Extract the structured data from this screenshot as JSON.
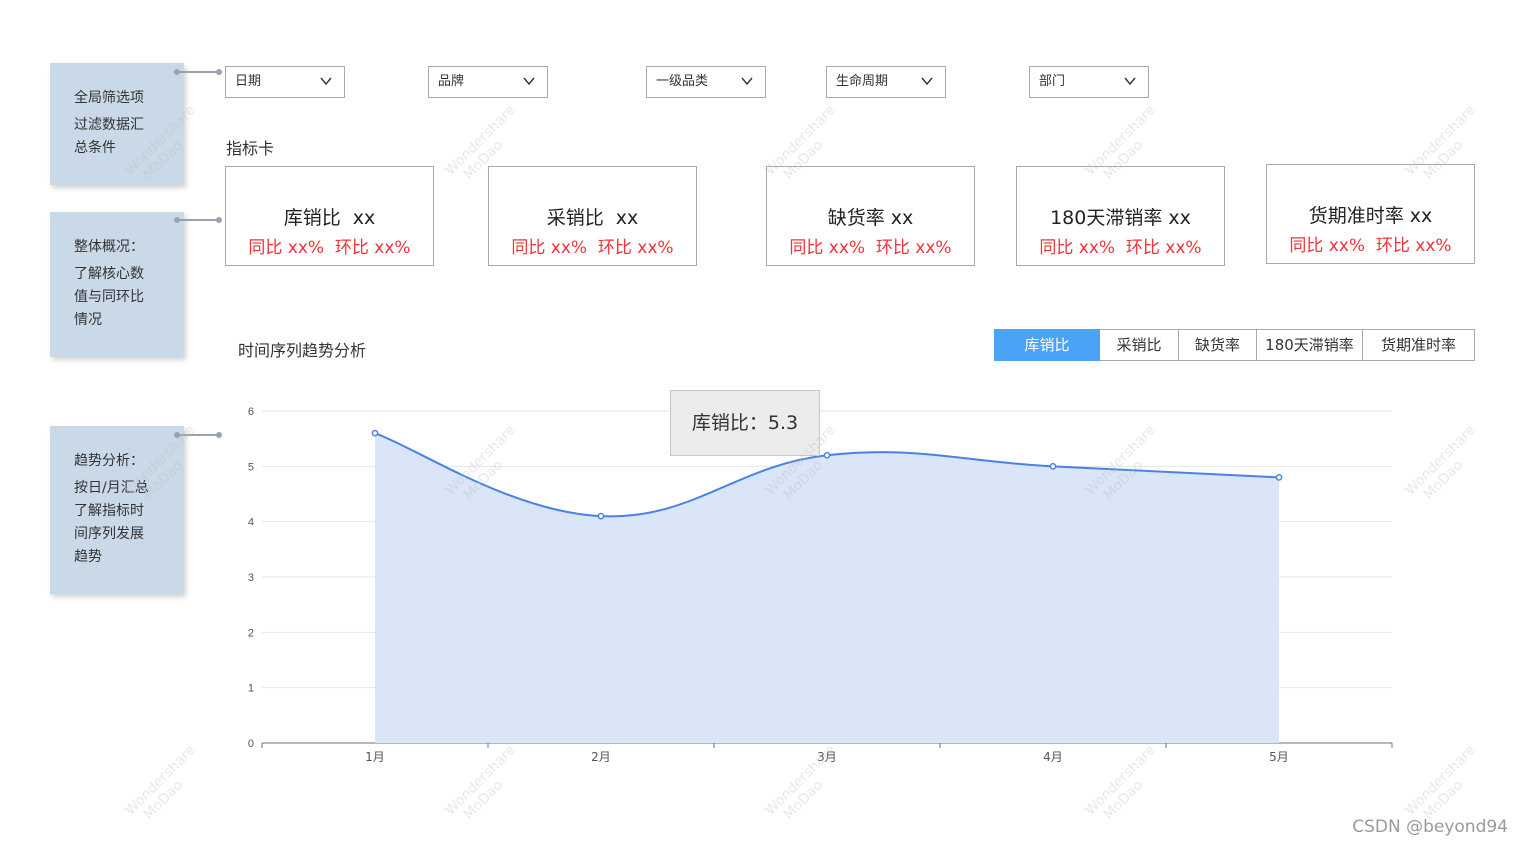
{
  "notes": [
    {
      "lines": [
        "全局筛选项",
        "过滤数据汇",
        "总条件"
      ]
    },
    {
      "lines": [
        "整体概况：",
        "了解核心数",
        "值与同环比",
        "情况"
      ]
    },
    {
      "lines": [
        "趋势分析：",
        "按日/月汇总",
        "了解指标时",
        "间序列发展",
        "趋势"
      ]
    }
  ],
  "filters": [
    {
      "label": "日期"
    },
    {
      "label": "品牌"
    },
    {
      "label": "一级品类"
    },
    {
      "label": "生命周期"
    },
    {
      "label": "部门"
    }
  ],
  "kpi_section_title": "指标卡",
  "kpis": [
    {
      "name": "库销比  xx",
      "compare": "同比 xx%  环比 xx%"
    },
    {
      "name": "采销比  xx",
      "compare": "同比 xx%  环比 xx%"
    },
    {
      "name": "缺货率 xx",
      "compare": "同比 xx%  环比 xx%"
    },
    {
      "name": "180天滞销率 xx",
      "compare": "同比 xx%  环比 xx%"
    },
    {
      "name": "货期准时率 xx",
      "compare": "同比 xx%  环比 xx%"
    }
  ],
  "trend_title": "时间序列趋势分析",
  "tabs": [
    {
      "label": "库销比",
      "active": true
    },
    {
      "label": "采销比",
      "active": false
    },
    {
      "label": "缺货率",
      "active": false
    },
    {
      "label": "180天滞销率",
      "active": false
    },
    {
      "label": "货期准时率",
      "active": false
    }
  ],
  "tooltip": "库销比：5.3",
  "chart_data": {
    "type": "area",
    "categories": [
      "1月",
      "2月",
      "3月",
      "4月",
      "5月"
    ],
    "series": [
      {
        "values": [
          5.6,
          4.1,
          5.2,
          5.0,
          4.8
        ]
      }
    ],
    "ylim": [
      0,
      6
    ],
    "yticks": [
      0,
      1,
      2,
      3,
      4,
      5,
      6
    ],
    "grid": true,
    "line_color": "#4a82e4",
    "fill_color": "#dae5f8"
  },
  "watermark": {
    "line1": "Wondershare",
    "line2": "MoDao"
  },
  "credit": "CSDN @beyond94"
}
